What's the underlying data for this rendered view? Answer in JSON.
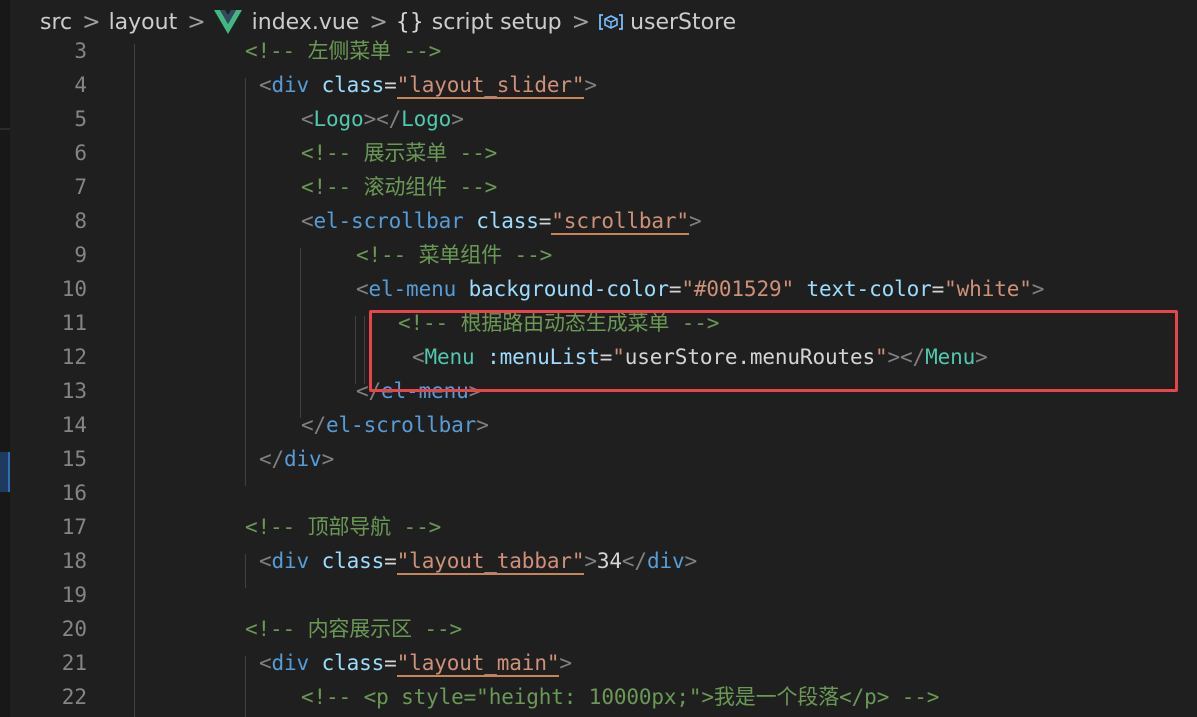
{
  "breadcrumb": {
    "items": [
      {
        "label": "src"
      },
      {
        "label": "layout"
      },
      {
        "label": "index.vue",
        "icon": "vue-logo-icon"
      },
      {
        "label": "script setup",
        "icon": "braces-icon"
      },
      {
        "label": "userStore",
        "icon": "variable-box-icon"
      }
    ],
    "separator": ">",
    "braces": "{}"
  },
  "colors": {
    "background": "#1f1f1f",
    "line_number": "#858585",
    "punctuation": "#808080",
    "tag": "#569cd6",
    "component": "#4ec9b0",
    "attribute": "#9cdcfe",
    "string": "#ce9178",
    "comment": "#6a9955",
    "text": "#d4d4d4",
    "highlight_box": "#e8444b"
  },
  "editor": {
    "lines": [
      {
        "n": "3",
        "tokens": [
          [
            "cmt",
            "<!-- 左侧菜单 -->"
          ]
        ]
      },
      {
        "n": "4",
        "tokens": [
          [
            "punc",
            "<"
          ],
          [
            "tag",
            "div"
          ],
          [
            "txt",
            " "
          ],
          [
            "attr",
            "class"
          ],
          [
            "txt",
            "="
          ],
          [
            "strul",
            "\"layout_slider\""
          ],
          [
            "punc",
            ">"
          ]
        ]
      },
      {
        "n": "5",
        "tokens": [
          [
            "punc",
            "<"
          ],
          [
            "comp",
            "Logo"
          ],
          [
            "punc",
            "></"
          ],
          [
            "comp",
            "Logo"
          ],
          [
            "punc",
            ">"
          ]
        ]
      },
      {
        "n": "6",
        "tokens": [
          [
            "cmt",
            "<!-- 展示菜单 -->"
          ]
        ]
      },
      {
        "n": "7",
        "tokens": [
          [
            "cmt",
            "<!-- 滚动组件 -->"
          ]
        ]
      },
      {
        "n": "8",
        "tokens": [
          [
            "punc",
            "<"
          ],
          [
            "tag",
            "el-scrollbar"
          ],
          [
            "txt",
            " "
          ],
          [
            "attr",
            "class"
          ],
          [
            "txt",
            "="
          ],
          [
            "strul",
            "\"scrollbar\""
          ],
          [
            "punc",
            ">"
          ]
        ]
      },
      {
        "n": "9",
        "tokens": [
          [
            "cmt",
            "<!-- 菜单组件 -->"
          ]
        ]
      },
      {
        "n": "10",
        "tokens": [
          [
            "punc",
            "<"
          ],
          [
            "tag",
            "el-menu"
          ],
          [
            "txt",
            " "
          ],
          [
            "attr",
            "background-color"
          ],
          [
            "txt",
            "="
          ],
          [
            "str",
            "\"#001529\""
          ],
          [
            "txt",
            " "
          ],
          [
            "attr",
            "text-color"
          ],
          [
            "txt",
            "="
          ],
          [
            "str",
            "\"white\""
          ],
          [
            "punc",
            ">"
          ]
        ]
      },
      {
        "n": "11",
        "tokens": [
          [
            "cmt",
            "<!-- 根据路由动态生成菜单 -->"
          ]
        ]
      },
      {
        "n": "12",
        "tokens": [
          [
            "punc",
            "<"
          ],
          [
            "comp",
            "Menu"
          ],
          [
            "txt",
            " "
          ],
          [
            "attr",
            ":menuList"
          ],
          [
            "txt",
            "="
          ],
          [
            "str",
            "\""
          ],
          [
            "txt",
            "userStore.menuRoutes"
          ],
          [
            "str",
            "\""
          ],
          [
            "punc",
            "></"
          ],
          [
            "comp",
            "Menu"
          ],
          [
            "punc",
            ">"
          ]
        ]
      },
      {
        "n": "13",
        "tokens": [
          [
            "punc",
            "</"
          ],
          [
            "tag",
            "el-menu"
          ],
          [
            "punc",
            ">"
          ]
        ]
      },
      {
        "n": "14",
        "tokens": [
          [
            "punc",
            "</"
          ],
          [
            "tag",
            "el-scrollbar"
          ],
          [
            "punc",
            ">"
          ]
        ]
      },
      {
        "n": "15",
        "tokens": [
          [
            "punc",
            "</"
          ],
          [
            "tag",
            "div"
          ],
          [
            "punc",
            ">"
          ]
        ]
      },
      {
        "n": "16",
        "tokens": []
      },
      {
        "n": "17",
        "tokens": [
          [
            "cmt",
            "<!-- 顶部导航 -->"
          ]
        ]
      },
      {
        "n": "18",
        "tokens": [
          [
            "punc",
            "<"
          ],
          [
            "tag",
            "div"
          ],
          [
            "txt",
            " "
          ],
          [
            "attr",
            "class"
          ],
          [
            "txt",
            "="
          ],
          [
            "strul",
            "\"layout_tabbar\""
          ],
          [
            "punc",
            ">"
          ],
          [
            "txt",
            "34"
          ],
          [
            "punc",
            "</"
          ],
          [
            "tag",
            "div"
          ],
          [
            "punc",
            ">"
          ]
        ]
      },
      {
        "n": "19",
        "tokens": []
      },
      {
        "n": "20",
        "tokens": [
          [
            "cmt",
            "<!-- 内容展示区 -->"
          ]
        ]
      },
      {
        "n": "21",
        "tokens": [
          [
            "punc",
            "<"
          ],
          [
            "tag",
            "div"
          ],
          [
            "txt",
            " "
          ],
          [
            "attr",
            "class"
          ],
          [
            "txt",
            "="
          ],
          [
            "strul",
            "\"layout_main\""
          ],
          [
            "punc",
            ">"
          ]
        ]
      },
      {
        "n": "22",
        "tokens": [
          [
            "cmt",
            "<!-- <p style=\"height: 10000px;\">我是一个段落</p> -->"
          ]
        ]
      }
    ]
  }
}
